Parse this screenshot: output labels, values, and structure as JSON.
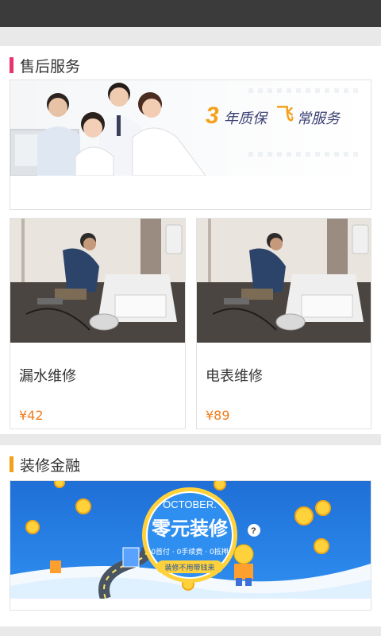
{
  "colors": {
    "after_sales_marker": "#e8336d",
    "finance_marker": "#f4a11a",
    "price": "#f07d1c"
  },
  "after_sales": {
    "title": "售后服务",
    "banner_text": {
      "three": "3",
      "a": "年质保",
      "fei": "飞",
      "b": "常服务"
    },
    "products": [
      {
        "name": "漏水维修",
        "price": "¥42"
      },
      {
        "name": "电表维修",
        "price": "¥89"
      }
    ]
  },
  "finance": {
    "title": "装修金融",
    "banner": {
      "month": "OCTOBER.",
      "headline": "零元装修",
      "perks": "0首付 · 0手续费 · 0抵押",
      "ribbon": "装修不用带钱来"
    }
  }
}
